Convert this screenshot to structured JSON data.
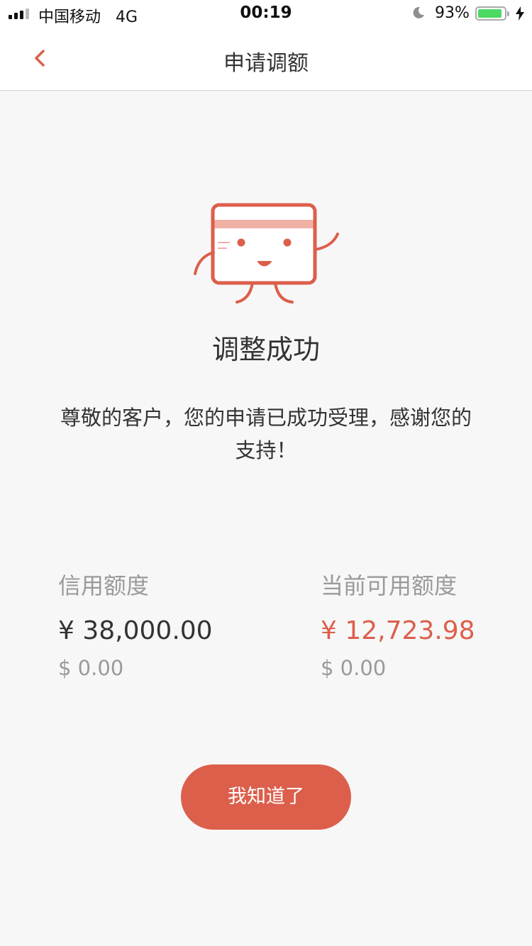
{
  "status_bar": {
    "carrier": "中国移动",
    "network": "4G",
    "time": "00:19",
    "battery_percent": "93%",
    "battery_level": 0.93
  },
  "nav": {
    "title": "申请调额",
    "back_icon": "chevron-left-icon"
  },
  "result": {
    "illustration": "card-mascot-icon",
    "title": "调整成功",
    "message": "尊敬的客户，您的申请已成功受理，感谢您的支持！"
  },
  "credit_limit": {
    "label": "信用额度",
    "cny": "¥ 38,000.00",
    "usd": "$ 0.00"
  },
  "available_limit": {
    "label": "当前可用额度",
    "cny": "¥ 12,723.98",
    "usd": "$ 0.00"
  },
  "button": {
    "label": "我知道了"
  },
  "colors": {
    "accent": "#dc5f4b",
    "background": "#f7f7f7",
    "text": "#333333",
    "muted": "#9a9a9a"
  }
}
